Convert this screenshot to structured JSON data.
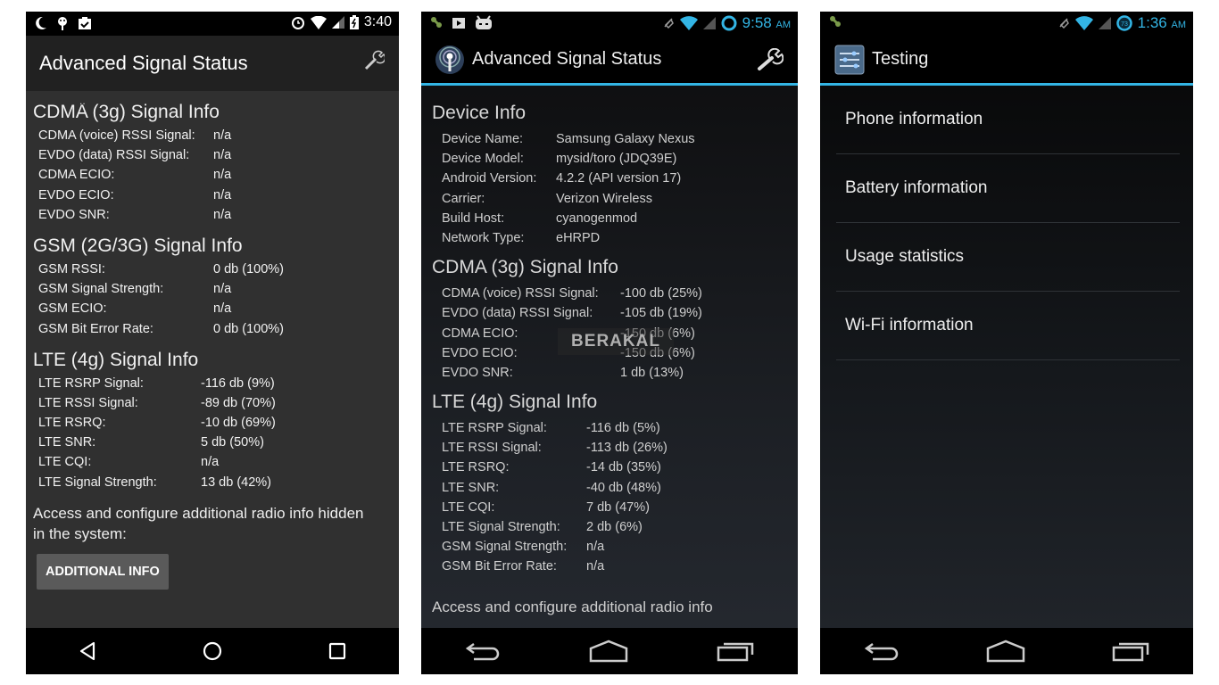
{
  "screens": [
    {
      "status": {
        "time": "3:40",
        "icons": [
          "moon-icon",
          "android-debug-icon",
          "clipboard-check-icon",
          "alarm-icon",
          "wifi-icon",
          "cell-signal-icon",
          "battery-charging-icon"
        ]
      },
      "title": "Advanced Signal Status",
      "action_icon": "wrench-icon",
      "cutoff_text": "..",
      "sections": [
        {
          "title": "CDMA (3g) Signal Info",
          "rows": [
            {
              "label": "CDMA (voice) RSSI Signal:",
              "value": "n/a"
            },
            {
              "label": "EVDO (data) RSSI Signal:",
              "value": "n/a"
            },
            {
              "label": "CDMA ECIO:",
              "value": "n/a"
            },
            {
              "label": "EVDO ECIO:",
              "value": "n/a"
            },
            {
              "label": "EVDO SNR:",
              "value": "n/a"
            }
          ]
        },
        {
          "title": "GSM (2G/3G) Signal Info",
          "rows": [
            {
              "label": "GSM RSSI:",
              "value": "0 db (100%)"
            },
            {
              "label": "GSM Signal Strength:",
              "value": "n/a"
            },
            {
              "label": "GSM ECIO:",
              "value": "n/a"
            },
            {
              "label": "GSM Bit Error Rate:",
              "value": "0 db (100%)"
            }
          ]
        },
        {
          "title": "LTE (4g) Signal Info",
          "rows": [
            {
              "label": "LTE RSRP Signal:",
              "value": "-116 db (9%)"
            },
            {
              "label": "LTE RSSI Signal:",
              "value": "-89 db (70%)"
            },
            {
              "label": "LTE RSRQ:",
              "value": "-10 db (69%)"
            },
            {
              "label": "LTE SNR:",
              "value": "5 db (50%)"
            },
            {
              "label": "LTE CQI:",
              "value": "n/a"
            },
            {
              "label": "LTE Signal Strength:",
              "value": "13 db (42%)"
            }
          ]
        }
      ],
      "note": "Access and configure additional radio info hidden in the system:",
      "button": "ADDITIONAL INFO",
      "nav": [
        "back-triangle-icon",
        "home-circle-icon",
        "recents-square-icon"
      ]
    },
    {
      "status": {
        "time": "9:58",
        "ampm": "AM",
        "icons": [
          "usb-debug-icon",
          "play-store-icon",
          "cyanogen-icon",
          "mute-icon",
          "wifi-icon",
          "cell-signal-icon",
          "sync-ring-icon"
        ]
      },
      "title": "Advanced Signal Status",
      "app_icon": "signal-tower-icon",
      "action_icon": "wrench-icon",
      "sections": [
        {
          "title": "Device Info",
          "rows": [
            {
              "label": "Device Name:",
              "value": "Samsung Galaxy Nexus"
            },
            {
              "label": "Device Model:",
              "value": "mysid/toro (JDQ39E)"
            },
            {
              "label": "Android Version:",
              "value": "4.2.2 (API version 17)"
            },
            {
              "label": "Carrier:",
              "value": "Verizon Wireless"
            },
            {
              "label": "Build Host:",
              "value": "cyanogenmod"
            },
            {
              "label": "Network Type:",
              "value": "eHRPD"
            }
          ]
        },
        {
          "title": "CDMA (3g) Signal Info",
          "rows": [
            {
              "label": "CDMA (voice) RSSI Signal:",
              "value": "-100 db (25%)"
            },
            {
              "label": "EVDO (data) RSSI Signal:",
              "value": "-105 db (19%)"
            },
            {
              "label": "CDMA ECIO:",
              "value": "-150 db (6%)"
            },
            {
              "label": "EVDO ECIO:",
              "value": "-150 db (6%)"
            },
            {
              "label": "EVDO SNR:",
              "value": "1 db (13%)"
            }
          ]
        },
        {
          "title": "LTE (4g) Signal Info",
          "rows": [
            {
              "label": "LTE RSRP Signal:",
              "value": "-116 db (5%)"
            },
            {
              "label": "LTE RSSI Signal:",
              "value": "-113 db (26%)"
            },
            {
              "label": "LTE RSRQ:",
              "value": "-14 db (35%)"
            },
            {
              "label": "LTE SNR:",
              "value": "-40 db (48%)"
            },
            {
              "label": "LTE CQI:",
              "value": "7 db (47%)"
            },
            {
              "label": "LTE Signal Strength:",
              "value": "2 db (6%)"
            },
            {
              "label": "GSM Signal Strength:",
              "value": "n/a"
            },
            {
              "label": "GSM Bit Error Rate:",
              "value": "n/a"
            }
          ]
        }
      ],
      "note": "Access and configure additional radio info",
      "watermark": "BERAKAL",
      "nav": [
        "back-arrow-icon",
        "home-icon",
        "recents-icon"
      ]
    },
    {
      "status": {
        "time": "1:36",
        "ampm": "AM",
        "battery_level": "73",
        "icons": [
          "usb-debug-icon",
          "mute-icon",
          "wifi-icon",
          "cell-signal-icon",
          "battery-ring-icon"
        ]
      },
      "title": "Testing",
      "app_icon": "settings-sliders-icon",
      "items": [
        "Phone information",
        "Battery information",
        "Usage statistics",
        "Wi-Fi information"
      ],
      "nav": [
        "back-arrow-icon",
        "home-icon",
        "recents-icon"
      ]
    }
  ],
  "colors": {
    "accent": "#33b5e5",
    "panel1_bg": "#303030",
    "button_bg": "#5a5a5a"
  }
}
